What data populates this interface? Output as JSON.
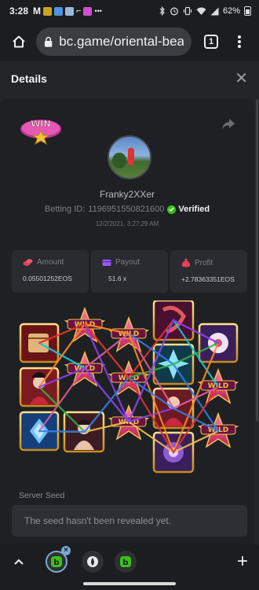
{
  "status": {
    "time": "3:28",
    "notif_text": "M",
    "battery": "62%",
    "icons": [
      "bluetooth-icon",
      "alarm-icon",
      "vibrate-icon",
      "wifi-icon",
      "signal-icon",
      "battery-icon"
    ]
  },
  "browser": {
    "url": "bc.game/oriental-beau",
    "tab_count": "1"
  },
  "details": {
    "title": "Details"
  },
  "bet": {
    "win_label": "WIN",
    "username": "Franky2XXer",
    "betting_id_label": "Betting ID:",
    "betting_id": "1196951550821600",
    "verified_label": "Verified",
    "timestamp": "12/2/2021, 3:27:29 AM"
  },
  "stats": [
    {
      "label": "Amount",
      "value": "0.05501252EOS",
      "icon": "coins-icon",
      "color": "#e8415a"
    },
    {
      "label": "Payout",
      "value": "51.6 x",
      "icon": "card-icon",
      "color": "#9a5bff"
    },
    {
      "label": "Profit",
      "value": "+2.78363351EOS",
      "icon": "money-bag-icon",
      "color": "#e8415a"
    }
  ],
  "game": {
    "wild_label": "WILD"
  },
  "server_seed": {
    "label": "Server Seed",
    "placeholder": "The seed hasn't been revealed yet."
  },
  "colors": {
    "accent_green": "#3bc117",
    "panel_bg": "#1e2023",
    "wild_gold": "#f0c24a"
  }
}
